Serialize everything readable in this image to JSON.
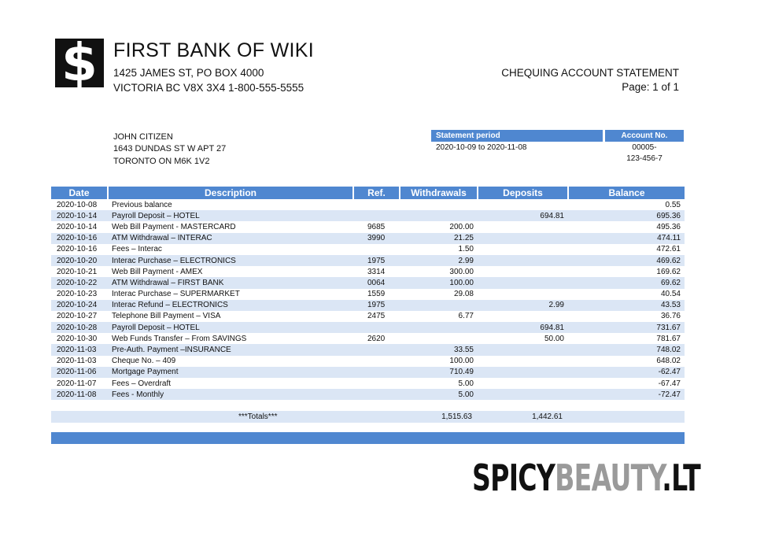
{
  "bank": {
    "logo_symbol": "$",
    "name": "FIRST BANK OF WIKI",
    "address_line1": "1425 JAMES ST, PO BOX 4000",
    "address_line2": "VICTORIA BC V8X 3X4 1-800-555-5555"
  },
  "statement": {
    "title": "CHEQUING ACCOUNT STATEMENT",
    "page": "Page: 1 of 1",
    "period_label": "Statement period",
    "period_value": "2020-10-09 to 2020-11-08",
    "account_label": "Account No.",
    "account_line1": "00005-",
    "account_line2": "123-456-7"
  },
  "customer": {
    "name": "JOHN CITIZEN",
    "street": "1643 DUNDAS ST W APT 27",
    "city": "TORONTO ON M6K 1V2"
  },
  "table": {
    "headers": [
      "Date",
      "Description",
      "Ref.",
      "Withdrawals",
      "Deposits",
      "Balance"
    ],
    "rows": [
      [
        "2020-10-08",
        "Previous balance",
        "",
        "",
        "",
        "0.55"
      ],
      [
        "2020-10-14",
        "Payroll Deposit – HOTEL",
        "",
        "",
        "694.81",
        "695.36"
      ],
      [
        "2020-10-14",
        "Web Bill Payment - MASTERCARD",
        "9685",
        "200.00",
        "",
        "495.36"
      ],
      [
        "2020-10-16",
        "ATM Withdrawal – INTERAC",
        "3990",
        "21.25",
        "",
        "474.11"
      ],
      [
        "2020-10-16",
        "Fees – Interac",
        "",
        "1.50",
        "",
        "472.61"
      ],
      [
        "2020-10-20",
        "Interac Purchase – ELECTRONICS",
        "1975",
        "2.99",
        "",
        "469.62"
      ],
      [
        "2020-10-21",
        "Web Bill Payment - AMEX",
        "3314",
        "300.00",
        "",
        "169.62"
      ],
      [
        "2020-10-22",
        "ATM Withdrawal – FIRST BANK",
        "0064",
        "100.00",
        "",
        "69.62"
      ],
      [
        "2020-10-23",
        "Interac Purchase – SUPERMARKET",
        "1559",
        "29.08",
        "",
        "40.54"
      ],
      [
        "2020-10-24",
        "Interac Refund – ELECTRONICS",
        "1975",
        "",
        "2.99",
        "43.53"
      ],
      [
        "2020-10-27",
        "Telephone Bill Payment – VISA",
        "2475",
        "6.77",
        "",
        "36.76"
      ],
      [
        "2020-10-28",
        "Payroll Deposit – HOTEL",
        "",
        "",
        "694.81",
        "731.67"
      ],
      [
        "2020-10-30",
        "Web Funds Transfer – From SAVINGS",
        "2620",
        "",
        "50.00",
        "781.67"
      ],
      [
        "2020-11-03",
        "Pre-Auth. Payment –INSURANCE",
        "",
        "33.55",
        "",
        "748.02"
      ],
      [
        "2020-11-03",
        "Cheque No. – 409",
        "",
        "100.00",
        "",
        "648.02"
      ],
      [
        "2020-11-06",
        "Mortgage Payment",
        "",
        "710.49",
        "",
        "-62.47"
      ],
      [
        "2020-11-07",
        "Fees – Overdraft",
        "",
        "5.00",
        "",
        "-67.47"
      ],
      [
        "2020-11-08",
        "Fees - Monthly",
        "",
        "5.00",
        "",
        "-72.47"
      ]
    ]
  },
  "totals": {
    "label": "***Totals***",
    "withdrawals": "1,515.63",
    "deposits": "1,442.61"
  },
  "watermark": {
    "part1": "SPICY",
    "part2": "BEAUTY",
    "part3": ".LT"
  },
  "colors": {
    "header_blue": "#4f87d0",
    "row_alt": "#dbe6f5"
  }
}
